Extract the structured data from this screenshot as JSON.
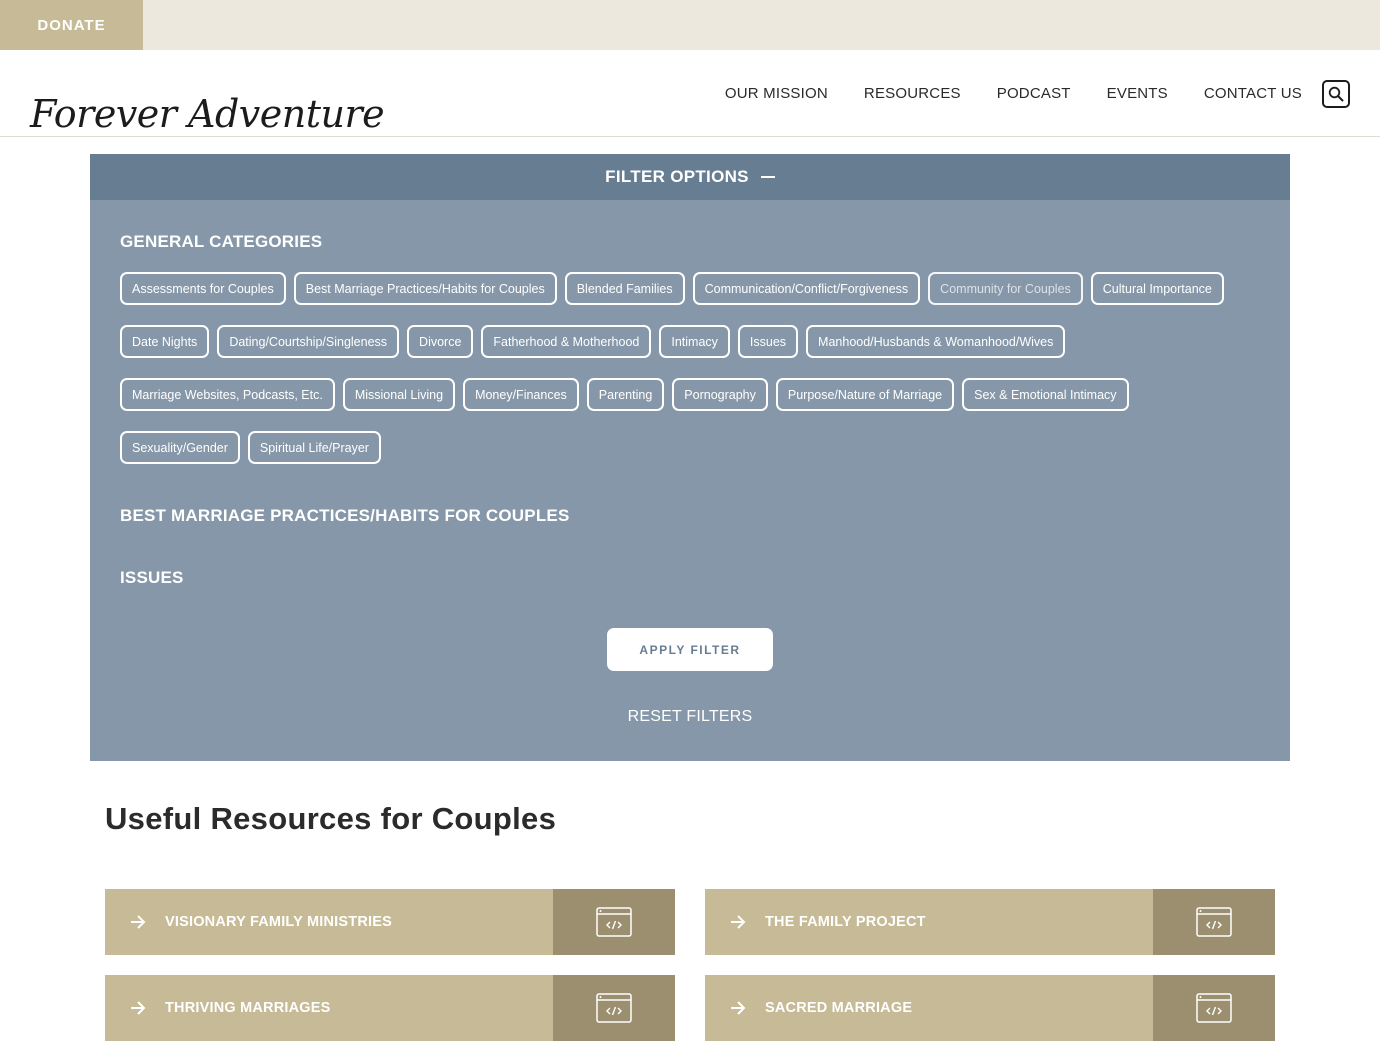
{
  "topbar": {
    "donate_label": "DONATE"
  },
  "header": {
    "logo_text": "Forever Adventure",
    "nav": [
      "OUR MISSION",
      "RESOURCES",
      "PODCAST",
      "EVENTS",
      "CONTACT US"
    ]
  },
  "filter": {
    "title": "FILTER OPTIONS",
    "general_title": "GENERAL CATEGORIES",
    "rows": [
      [
        "Assessments for Couples",
        "Best Marriage Practices/Habits for Couples",
        "Blended Families",
        "Communication/Conflict/Forgiveness",
        "Community for Couples",
        "Cultural Importance"
      ],
      [
        "Date Nights",
        "Dating/Courtship/Singleness",
        "Divorce",
        "Fatherhood & Motherhood",
        "Intimacy",
        "Issues",
        "Manhood/Husbands & Womanhood/Wives"
      ],
      [
        "Marriage Websites, Podcasts, Etc.",
        "Missional Living",
        "Money/Finances",
        "Parenting",
        "Pornography",
        "Purpose/Nature of Marriage",
        "Sex & Emotional Intimacy"
      ],
      [
        "Sexuality/Gender",
        "Spiritual Life/Prayer"
      ]
    ],
    "section2_title": "BEST MARRIAGE PRACTICES/HABITS FOR COUPLES",
    "section3_title": "ISSUES",
    "apply_label": "APPLY FILTER",
    "reset_label": "RESET FILTERS"
  },
  "resources": {
    "title": "Useful Resources for Couples",
    "cards": [
      "VISIONARY FAMILY MINISTRIES",
      "THE FAMILY PROJECT",
      "THRIVING MARRIAGES",
      "SACRED MARRIAGE"
    ]
  },
  "colors": {
    "accent_tan": "#c7ba96",
    "accent_dark_tan": "#9c8f6f",
    "panel_blue": "#8597a8",
    "panel_header_blue": "#667d92",
    "topbar_bg": "#ede8dd"
  }
}
